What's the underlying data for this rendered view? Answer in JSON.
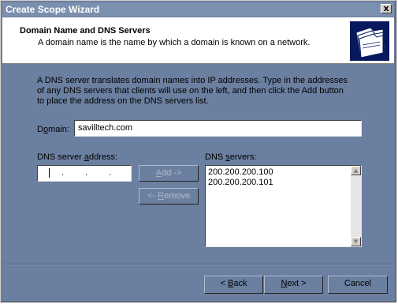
{
  "window": {
    "title": "Create Scope Wizard",
    "close_label": "x"
  },
  "header": {
    "title": "Domain Name and DNS Servers",
    "subtitle": "A domain name is the name by which a domain is known on a network.",
    "icon": "folders-icon"
  },
  "intro_text": "A DNS server translates domain names into IP addresses. Type in the addresses of any DNS servers that clients will use on the left, and then click the Add button to place the address on the DNS servers list.",
  "domain": {
    "label_pre": "D",
    "label_accel": "o",
    "label_post": "main:",
    "value": "savilltech.com"
  },
  "dns_address": {
    "label_pre": "DNS server ",
    "label_accel": "a",
    "label_post": "ddress:",
    "dots": [
      ".",
      ".",
      "."
    ]
  },
  "buttons": {
    "add_pre": "",
    "add_accel": "A",
    "add_post": "dd ->",
    "remove_pre": "<- ",
    "remove_accel": "R",
    "remove_post": "emove"
  },
  "dns_servers": {
    "label_pre": "DNS ",
    "label_accel": "s",
    "label_post": "ervers:",
    "items": [
      "200.200.200.100",
      "200.200.200.101"
    ]
  },
  "footer": {
    "back_pre": "< ",
    "back_accel": "B",
    "back_post": "ack",
    "next_pre": "",
    "next_accel": "N",
    "next_post": "ext >",
    "cancel": "Cancel"
  },
  "colors": {
    "dialog_bg": "#6b7fa0",
    "titlebar": "#7b8fae",
    "icon_bg": "#07185c"
  }
}
